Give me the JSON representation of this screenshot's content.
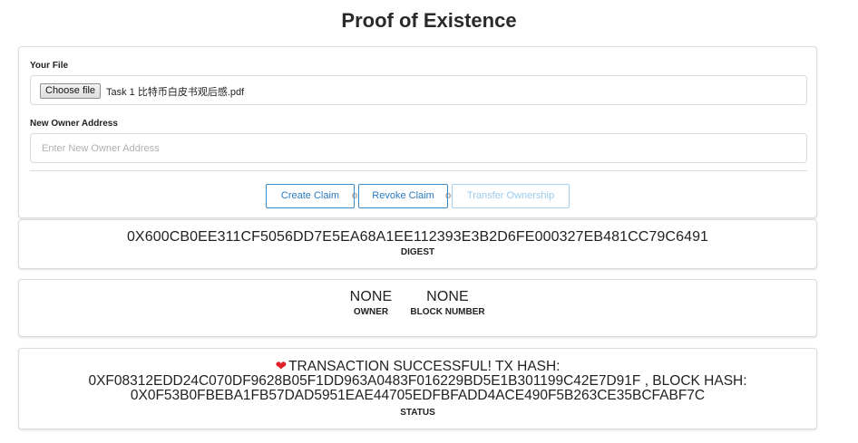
{
  "app": {
    "title": "Proof of Existence"
  },
  "form": {
    "file_label": "Your File",
    "file_button": "Choose file",
    "file_name": "Task 1 比特币白皮书观后感.pdf",
    "owner_label": "New Owner Address",
    "owner_value": "",
    "owner_placeholder": "Enter New Owner Address"
  },
  "actions": {
    "create": "Create Claim",
    "revoke": "Revoke Claim",
    "transfer": "Transfer Ownership",
    "separator": "or",
    "transfer_disabled": true
  },
  "digest": {
    "value": "0X600CB0EE311CF5056DD7E5EA68A1EE112393E3B2D6FE000327EB481CC79C6491",
    "label": "DIGEST"
  },
  "ownership": {
    "owner_value": "NONE",
    "owner_label": "OWNER",
    "block_value": "NONE",
    "block_label": "BLOCK NUMBER"
  },
  "status": {
    "icon": "heart-icon",
    "line1": "TRANSACTION SUCCESSFUL! TX HASH:",
    "line2": "0XF08312EDD24C070DF9628B05F1DD963A0483F016229BD5E1B301199C42E7D91F , BLOCK HASH:",
    "line3": "0X0F53B0FBEBA1FB57DAD5951EAE44705EDFBFADD4ACE490F5B263CE35BCFABF7C",
    "label": "STATUS"
  },
  "colors": {
    "accent": "#2b7bbf",
    "accent_disabled": "#9ccbee",
    "heart": "#e0202a",
    "border": "#dcdcdc"
  }
}
